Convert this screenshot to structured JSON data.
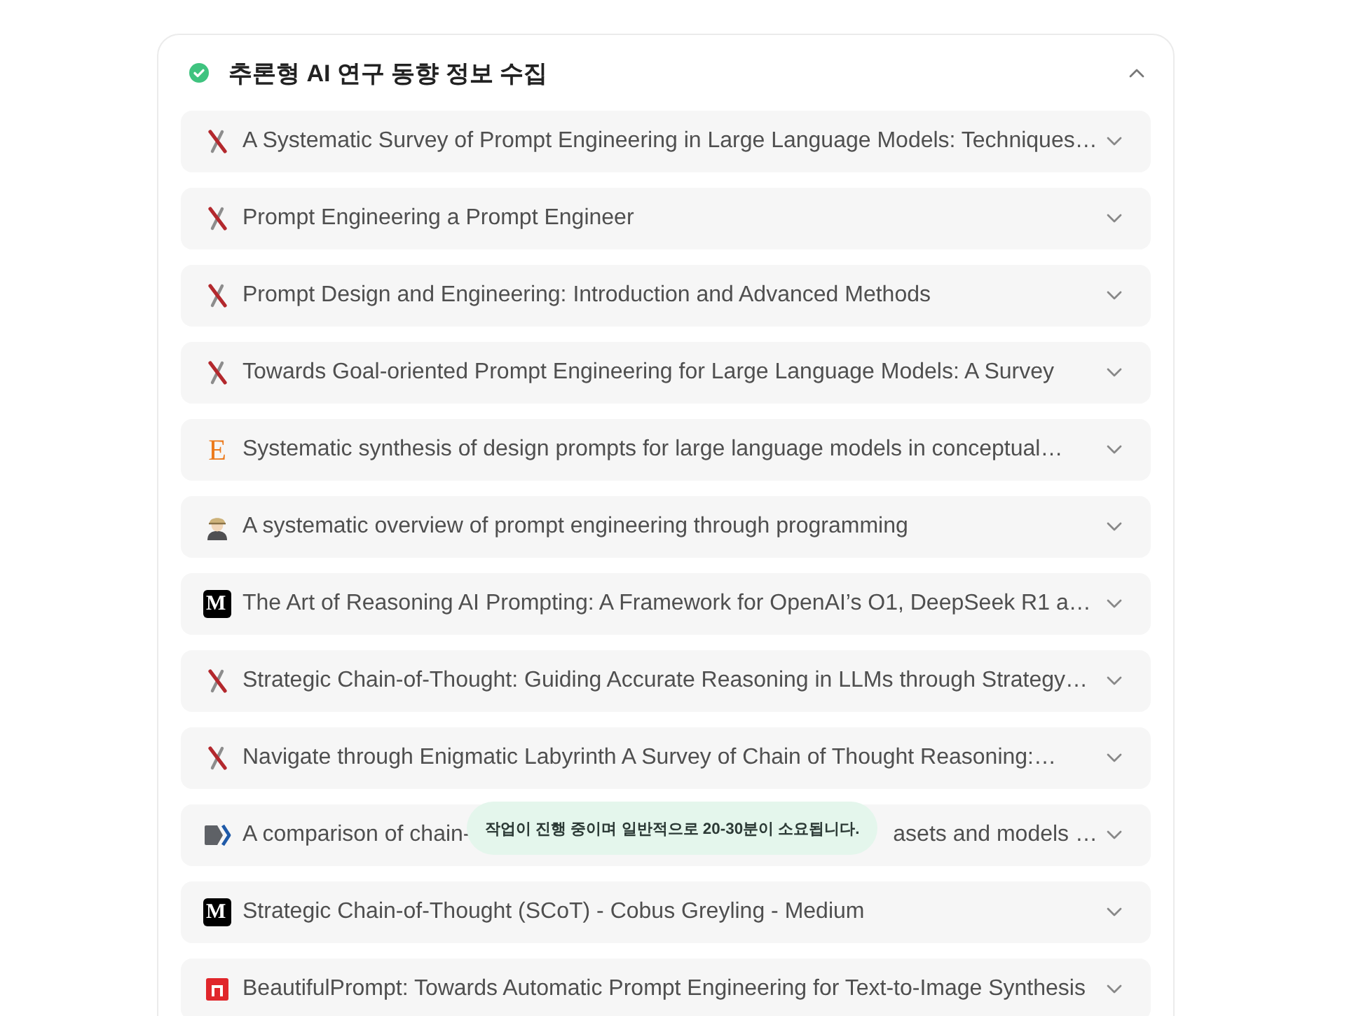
{
  "task": {
    "title": "추론형 AI 연구 동향 정보 수집",
    "completed": true,
    "expanded": true
  },
  "sources": [
    {
      "kind": "cross",
      "title": "A Systematic Survey of Prompt Engineering in Large Language Models: Techniques…",
      "expanded": false
    },
    {
      "kind": "cross",
      "title": "Prompt Engineering a Prompt Engineer",
      "expanded": false
    },
    {
      "kind": "cross",
      "title": "Prompt Design and Engineering: Introduction and Advanced Methods",
      "expanded": false
    },
    {
      "kind": "cross",
      "title": "Towards Goal-oriented Prompt Engineering for Large Language Models: A Survey",
      "expanded": false
    },
    {
      "kind": "letter",
      "logo_text": "E",
      "title": "Systematic synthesis of design prompts for large language models in conceptual…",
      "expanded": false
    },
    {
      "kind": "figure",
      "title": "A systematic overview of prompt engineering through programming",
      "expanded": false
    },
    {
      "kind": "tile",
      "logo_text": "M",
      "title": "The Art of Reasoning AI Prompting: A Framework for OpenAI’s O1, DeepSeek R1 a…",
      "expanded": false
    },
    {
      "kind": "cross",
      "title": "Strategic Chain-of-Thought: Guiding Accurate Reasoning in LLMs through Strategy…",
      "expanded": false
    },
    {
      "kind": "cross",
      "title": "Navigate through Enigmatic Labyrinth A Survey of Chain of Thought Reasoning:…",
      "expanded": false
    },
    {
      "kind": "tag",
      "title": "A comparison of chain-",
      "title_tail": "asets and models …",
      "expanded": false
    },
    {
      "kind": "tile",
      "logo_text": "M",
      "title": "Strategic Chain-of-Thought (SCoT) - Cobus Greyling - Medium",
      "expanded": false
    },
    {
      "kind": "square",
      "title": "BeautifulPrompt: Towards Automatic Prompt Engineering for Text-to-Image Synthesis",
      "expanded": false
    }
  ],
  "toast": {
    "text": "작업이 진행 중이며 일반적으로 20-30분이 소요됩니다."
  }
}
